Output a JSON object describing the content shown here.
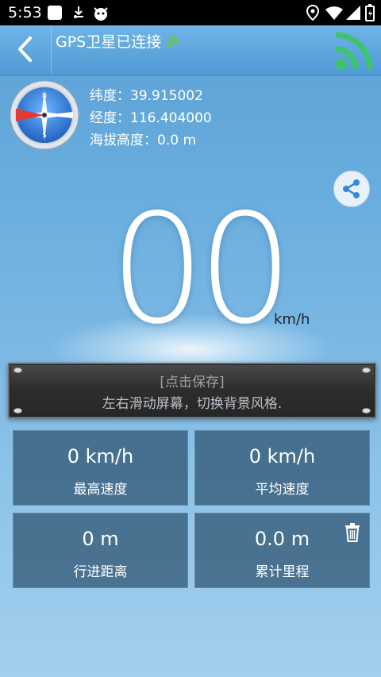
{
  "status_bar": {
    "time": "5:53"
  },
  "header": {
    "title": "GPS卫星已连接"
  },
  "location": {
    "latitude": "纬度：39.915002",
    "longitude": "经度：116.404000",
    "altitude": "海拔高度：0.0 m"
  },
  "speed": {
    "value": "00",
    "unit": "km/h"
  },
  "plate": {
    "line1": "[点击保存]",
    "line2": "左右滑动屏幕，切换背景风格."
  },
  "stats": [
    {
      "value": "0 km/h",
      "label": "最高速度"
    },
    {
      "value": "0 km/h",
      "label": "平均速度"
    },
    {
      "value": "0 m",
      "label": "行进距离"
    },
    {
      "value": "0.0 m",
      "label": "累计里程"
    }
  ],
  "colors": {
    "header": "#4f9bd5",
    "accent_green": "#3ec46d",
    "card": "#2c506e"
  },
  "icons": [
    "back-icon",
    "satellite-signal-icon",
    "wifi-signal-icon",
    "compass-icon",
    "share-icon",
    "trash-icon"
  ]
}
